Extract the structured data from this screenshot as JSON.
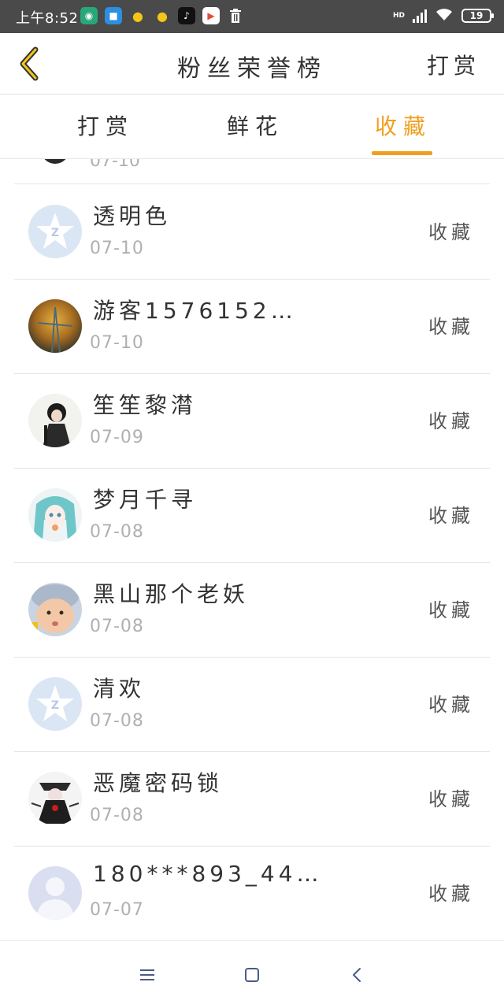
{
  "status": {
    "time": "上午8:52",
    "battery": "19",
    "network": "HD"
  },
  "header": {
    "title": "粉丝荣誉榜",
    "right_action": "打赏"
  },
  "tabs": [
    {
      "label": "打赏",
      "active": false
    },
    {
      "label": "鲜花",
      "active": false
    },
    {
      "label": "收藏",
      "active": true
    }
  ],
  "accent_color": "#f0a020",
  "list": {
    "partial_date": "07-10",
    "rows": [
      {
        "name": "透明色",
        "date": "07-10",
        "action": "收藏"
      },
      {
        "name": "游客1576152…",
        "date": "07-10",
        "action": "收藏"
      },
      {
        "name": "笙笙黎潸",
        "date": "07-09",
        "action": "收藏"
      },
      {
        "name": "梦月千寻",
        "date": "07-08",
        "action": "收藏"
      },
      {
        "name": "黑山那个老妖",
        "date": "07-08",
        "action": "收藏"
      },
      {
        "name": "清欢",
        "date": "07-08",
        "action": "收藏"
      },
      {
        "name": "恶魔密码锁",
        "date": "07-08",
        "action": "收藏"
      },
      {
        "name": "180***893_44…",
        "date": "07-07",
        "action": "收藏"
      }
    ]
  },
  "icons": {
    "back": "back-chevron-icon",
    "nav": [
      "menu-icon",
      "home-icon",
      "back-icon"
    ]
  }
}
